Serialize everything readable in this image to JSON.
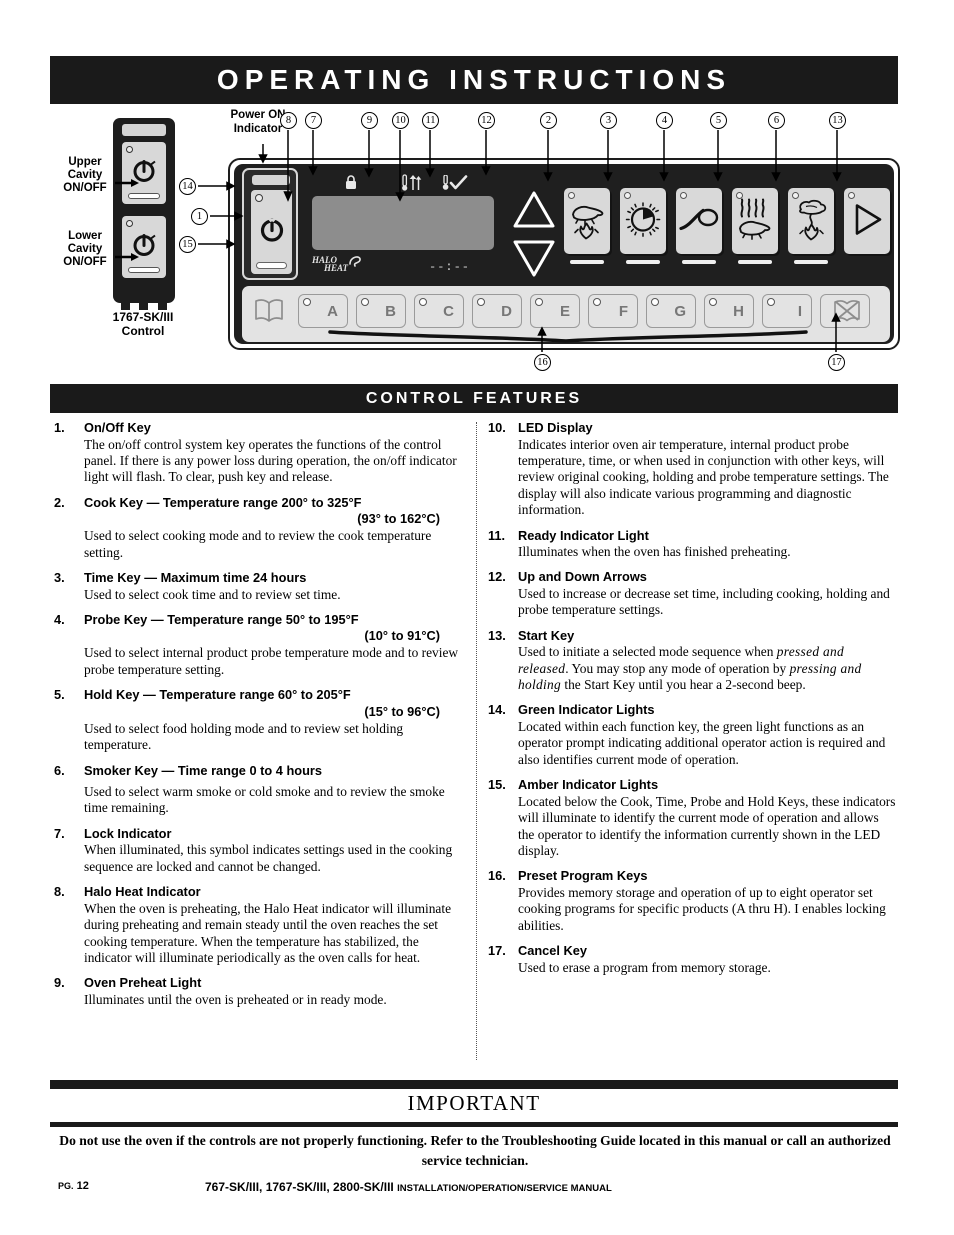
{
  "header": {
    "title": "OPERATING INSTRUCTIONS"
  },
  "diagram": {
    "tower": {
      "upper_label": "Upper\nCavity\nON/OFF",
      "upper_label_l1": "Upper",
      "upper_label_l2": "Cavity",
      "upper_label_l3": "ON/OFF",
      "lower_label_l1": "Lower",
      "lower_label_l2": "Cavity",
      "lower_label_l3": "ON/OFF",
      "model_l1": "1767-SK/III",
      "model_l2": "Control"
    },
    "power_on_indicator_l1": "Power ON",
    "power_on_indicator_l2": "Indicator",
    "halo_heat_l1": "HALO",
    "halo_heat_l2": "HEAT",
    "time_display": "--:--",
    "function_keys": [
      {
        "name": "cook-key",
        "icon": "roast-over-flame-icon",
        "has_amber": true
      },
      {
        "name": "time-key",
        "icon": "clock-dial-icon",
        "has_amber": true
      },
      {
        "name": "probe-key",
        "icon": "probe-needle-icon",
        "has_amber": true
      },
      {
        "name": "hold-key",
        "icon": "heat-waves-roast-icon",
        "has_amber": true
      },
      {
        "name": "smoker-key",
        "icon": "smoke-plume-icon",
        "has_amber": true
      },
      {
        "name": "start-key",
        "icon": "play-triangle-icon",
        "has_amber": false
      }
    ],
    "preset_keys": [
      "A",
      "B",
      "C",
      "D",
      "E",
      "F",
      "G",
      "H",
      "I"
    ],
    "callouts": [
      {
        "n": "8",
        "glyph": "⑧"
      },
      {
        "n": "7",
        "glyph": "⑦"
      },
      {
        "n": "9",
        "glyph": "⑨"
      },
      {
        "n": "10",
        "glyph": "⑩"
      },
      {
        "n": "11",
        "glyph": "⑪"
      },
      {
        "n": "12",
        "glyph": "⑫"
      },
      {
        "n": "2",
        "glyph": "②"
      },
      {
        "n": "3",
        "glyph": "③"
      },
      {
        "n": "4",
        "glyph": "④"
      },
      {
        "n": "5",
        "glyph": "⑤"
      },
      {
        "n": "6",
        "glyph": "⑥"
      },
      {
        "n": "13",
        "glyph": "⑬"
      },
      {
        "n": "14",
        "glyph": "⑭"
      },
      {
        "n": "1",
        "glyph": "①"
      },
      {
        "n": "15",
        "glyph": "⑮"
      },
      {
        "n": "16",
        "glyph": "⑯"
      },
      {
        "n": "17",
        "glyph": "⑰"
      }
    ]
  },
  "section": {
    "title": "CONTROL FEATURES"
  },
  "features_left": [
    {
      "num": "1.",
      "head": "On/Off Key",
      "body": "The on/off control system key operates the functions of the control panel.  If there is any power loss during operation, the on/off indicator light will flash.  To clear, push key and release."
    },
    {
      "num": "2.",
      "head": "Cook Key — Temperature range 200° to 325°F",
      "head2": "(93° to 162°C)",
      "body": "Used to select cooking mode and to review the cook temperature setting."
    },
    {
      "num": "3.",
      "head": "Time Key — Maximum time 24 hours",
      "body": "Used to select cook time and to review set time."
    },
    {
      "num": "4.",
      "head": "Probe Key — Temperature range 50° to 195°F",
      "head2": "(10° to 91°C)",
      "body": "Used to select internal product probe temperature mode and to review probe temperature setting."
    },
    {
      "num": "5.",
      "head": "Hold Key — Temperature range 60° to 205°F",
      "head2": "(15° to 96°C)",
      "body": "Used to select food holding mode and to review set holding temperature."
    },
    {
      "num": "6.",
      "head": "Smoker Key — Time range 0 to 4 hours",
      "body": "Used to select warm smoke or cold smoke and to review the smoke time remaining."
    },
    {
      "num": "7.",
      "head": "Lock Indicator",
      "body": "When illuminated, this symbol indicates settings used in the cooking sequence are locked and cannot be changed."
    },
    {
      "num": "8.",
      "head": "Halo Heat Indicator",
      "body": "When the oven is preheating, the Halo Heat indicator will illuminate during preheating and remain steady until the oven reaches the set cooking temperature. When the temperature has stabilized, the indicator will illuminate periodically as the oven calls for heat."
    },
    {
      "num": "9.",
      "head": "Oven Preheat Light",
      "body": "Illuminates until the oven is preheated or in ready mode."
    }
  ],
  "features_right": [
    {
      "num": "10.",
      "head": "LED Display",
      "body": "Indicates interior oven air temperature, internal product probe temperature, time, or when used in conjunction with other keys, will review original cooking, holding and probe temperature settings.  The display will also indicate various programming and diagnostic information."
    },
    {
      "num": "11.",
      "head": "Ready Indicator Light",
      "body": "Illuminates when the oven has finished preheating."
    },
    {
      "num": "12.",
      "head": "Up and Down Arrows",
      "body": "Used to increase or decrease set time, including cooking, holding and probe temperature settings."
    },
    {
      "num": "13.",
      "head": "Start Key",
      "body_pre": "Used to initiate a selected mode sequence when ",
      "body_em1": "pressed and released",
      "body_mid": ".  You may stop any mode of operation by ",
      "body_em2": "pressing and holding",
      "body_post": " the Start Key until you hear a 2-second beep."
    },
    {
      "num": "14.",
      "head": "Green Indicator Lights",
      "body": "Located within each function key, the green light functions as an operator prompt indicating additional operator action is required and also identifies current mode of operation."
    },
    {
      "num": "15.",
      "head": "Amber Indicator Lights",
      "body": "Located below the Cook, Time, Probe and Hold Keys, these indicators will illuminate to identify the current mode of operation and allows the operator to identify the information currently shown in the LED display."
    },
    {
      "num": "16.",
      "head": "Preset Program Keys",
      "body": "Provides memory storage and operation of up to eight operator set cooking programs for specific products (A thru H).  I enables locking abilities."
    },
    {
      "num": "17.",
      "head": "Cancel Key",
      "body": "Used to erase a program from memory storage."
    }
  ],
  "footer": {
    "important": "IMPORTANT",
    "warning": "Do not use the oven if the controls are not properly functioning.  Refer to the Troubleshooting Guide located in this manual or call an authorized service technician.",
    "page": "PG. 12",
    "page_prefix": "PG.",
    "page_num": "12",
    "manual_models": "767-SK/III, 1767-SK/III, 2800-SK/III",
    "manual_suffix": "INSTALLATION/OPERATION/SERVICE MANUAL"
  },
  "colors": {
    "ink": "#1a1a1a",
    "panel": "#1f1f1f",
    "key": "#d9d9d9",
    "display": "#8d8d8d"
  }
}
